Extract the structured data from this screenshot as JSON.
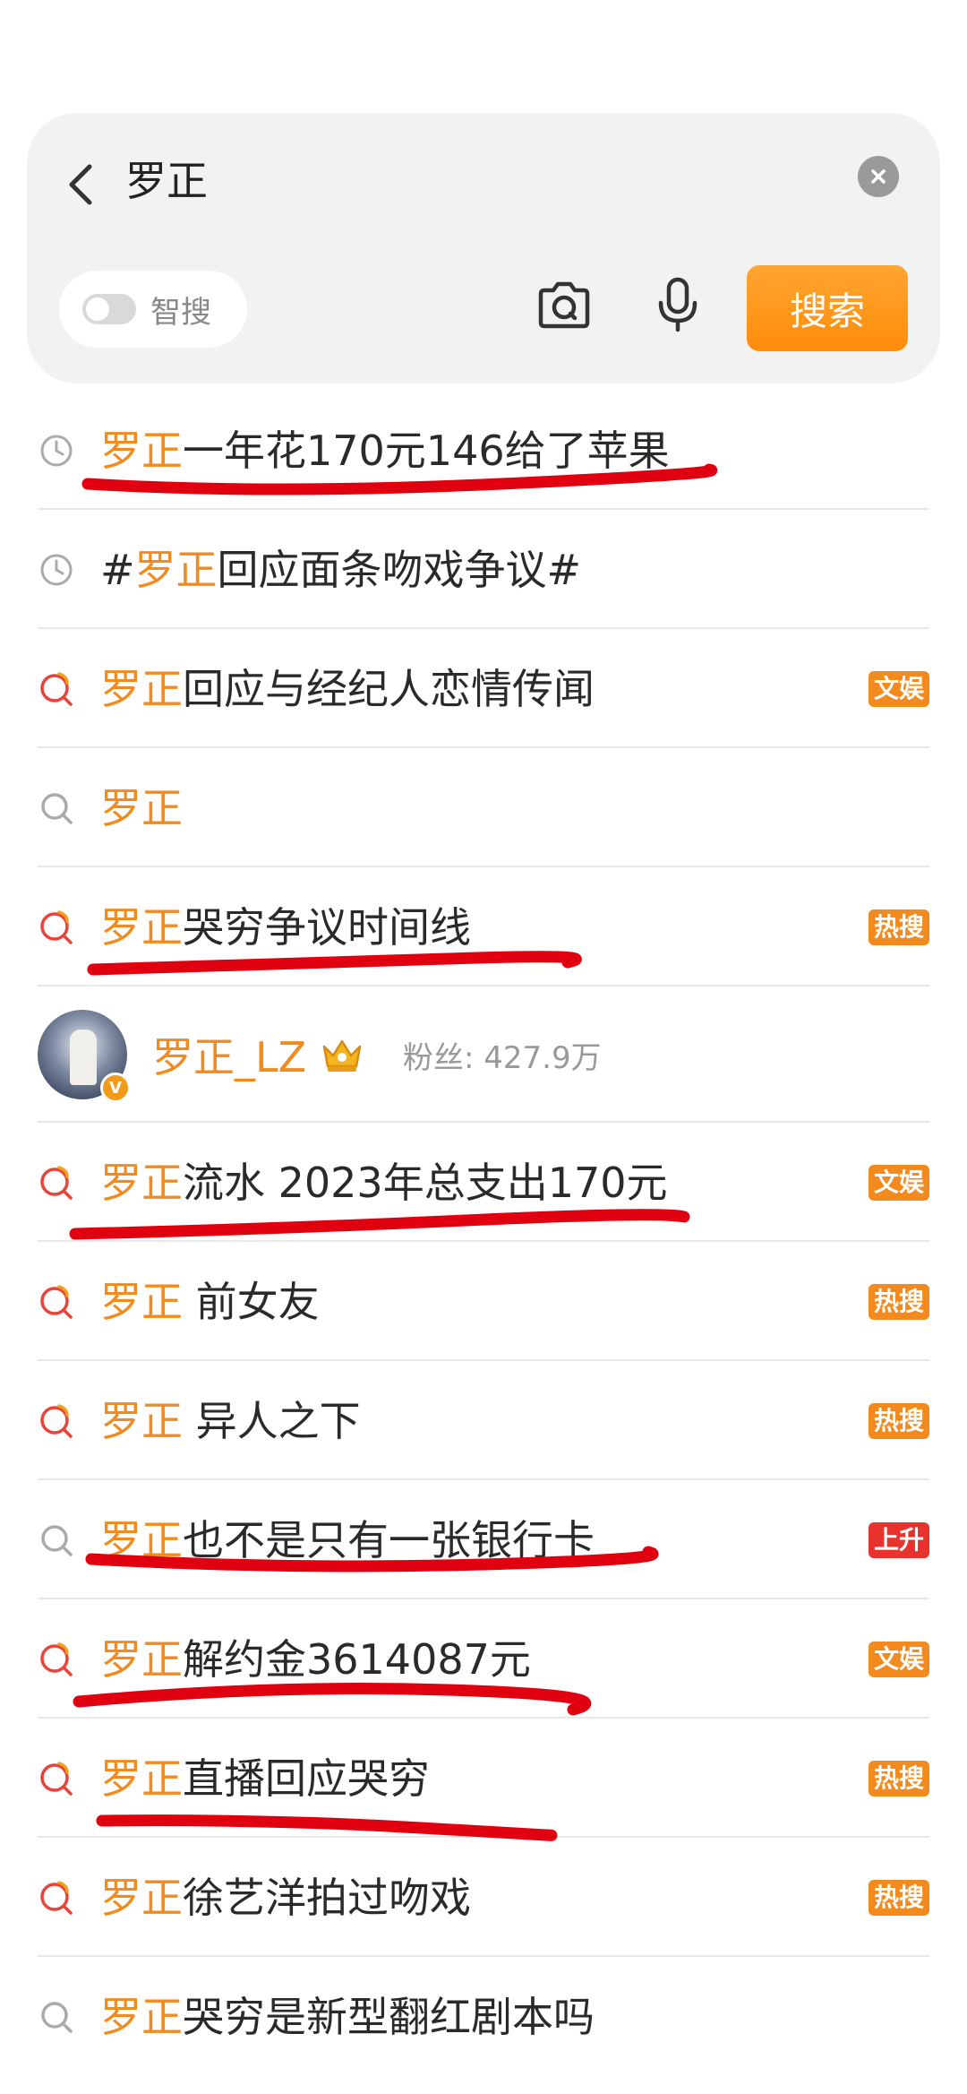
{
  "search": {
    "query": "罗正",
    "smart_search_label": "智搜",
    "smart_search_on": false,
    "search_button_label": "搜索"
  },
  "colors": {
    "keyword": "#f28a1e",
    "badge_orange": "#f28a1e",
    "badge_red": "#e8322d",
    "hot_icon": "#e8443a",
    "annotation_ink": "#e0000f"
  },
  "suggestions": [
    {
      "icon": "clock-icon",
      "prefix": "",
      "keyword": "罗正",
      "rest": "一年花170元146给了苹果",
      "badge": ""
    },
    {
      "icon": "clock-icon",
      "prefix": "#",
      "keyword": "罗正",
      "rest": "回应面条吻戏争议#",
      "badge": ""
    },
    {
      "icon": "hot-search-icon",
      "prefix": "",
      "keyword": "罗正",
      "rest": "回应与经纪人恋情传闻",
      "badge": "文娱"
    },
    {
      "icon": "search-icon",
      "prefix": "",
      "keyword": "罗正",
      "rest": "",
      "badge": ""
    },
    {
      "icon": "hot-search-icon",
      "prefix": "",
      "keyword": "罗正",
      "rest": "哭穷争议时间线",
      "badge": "热搜"
    },
    {
      "icon": "hot-search-icon",
      "prefix": "",
      "keyword": "罗正",
      "rest": "流水 2023年总支出170元",
      "badge": "文娱"
    },
    {
      "icon": "hot-search-icon",
      "prefix": "",
      "keyword": "罗正",
      "rest": " 前女友",
      "badge": "热搜"
    },
    {
      "icon": "hot-search-icon",
      "prefix": "",
      "keyword": "罗正",
      "rest": " 异人之下",
      "badge": "热搜"
    },
    {
      "icon": "search-icon",
      "prefix": "",
      "keyword": "罗正",
      "rest": "也不是只有一张银行卡",
      "badge": "上升"
    },
    {
      "icon": "hot-search-icon",
      "prefix": "",
      "keyword": "罗正",
      "rest": "解约金3614087元",
      "badge": "文娱"
    },
    {
      "icon": "hot-search-icon",
      "prefix": "",
      "keyword": "罗正",
      "rest": "直播回应哭穷",
      "badge": "热搜"
    },
    {
      "icon": "hot-search-icon",
      "prefix": "",
      "keyword": "罗正",
      "rest": "徐艺洋拍过吻戏",
      "badge": "热搜"
    },
    {
      "icon": "search-icon",
      "prefix": "",
      "keyword": "罗正",
      "rest": "哭穷是新型翻红剧本吗",
      "badge": ""
    }
  ],
  "user_card": {
    "name": "罗正_LZ",
    "fans": "粉丝: 427.9万",
    "verified_mark": "V"
  }
}
